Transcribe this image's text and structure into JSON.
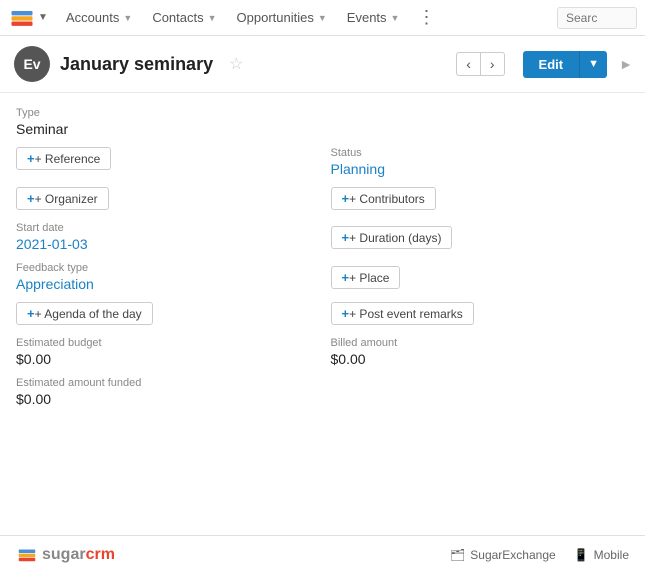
{
  "nav": {
    "accounts_label": "Accounts",
    "contacts_label": "Contacts",
    "opportunities_label": "Opportunities",
    "events_label": "Events",
    "search_placeholder": "Searc"
  },
  "header": {
    "avatar_text": "Ev",
    "title": "January seminary",
    "edit_label": "Edit"
  },
  "record": {
    "type_label": "Type",
    "type_value": "Seminar",
    "reference_btn": "+ Reference",
    "status_label": "Status",
    "status_value": "Planning",
    "organizer_btn": "+ Organizer",
    "contributors_btn": "+ Contributors",
    "start_date_label": "Start date",
    "start_date_value": "2021-01-03",
    "duration_btn": "+ Duration (days)",
    "feedback_type_label": "Feedback type",
    "feedback_type_value": "Appreciation",
    "place_btn": "+ Place",
    "agenda_btn": "+ Agenda of the day",
    "post_event_btn": "+ Post event remarks",
    "estimated_budget_label": "Estimated budget",
    "estimated_budget_value": "$0.00",
    "billed_amount_label": "Billed amount",
    "billed_amount_value": "$0.00",
    "estimated_funded_label": "Estimated amount funded",
    "estimated_funded_value": "$0.00"
  },
  "footer": {
    "logo_sugar": "sugar",
    "logo_crm": "crm",
    "sugar_exchange_label": "SugarExchange",
    "mobile_label": "Mobile"
  }
}
